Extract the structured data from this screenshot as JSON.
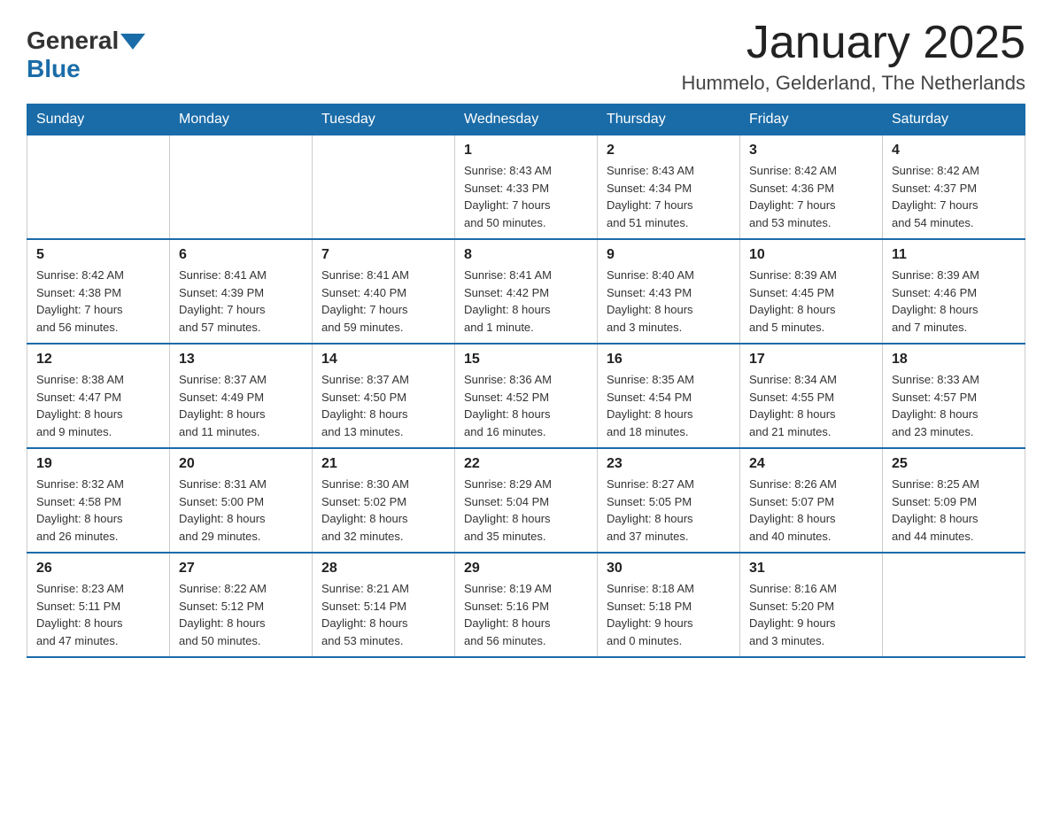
{
  "header": {
    "logo_general": "General",
    "logo_blue": "Blue",
    "month_title": "January 2025",
    "location": "Hummelo, Gelderland, The Netherlands"
  },
  "days_of_week": [
    "Sunday",
    "Monday",
    "Tuesday",
    "Wednesday",
    "Thursday",
    "Friday",
    "Saturday"
  ],
  "weeks": [
    [
      {
        "day": "",
        "info": ""
      },
      {
        "day": "",
        "info": ""
      },
      {
        "day": "",
        "info": ""
      },
      {
        "day": "1",
        "info": "Sunrise: 8:43 AM\nSunset: 4:33 PM\nDaylight: 7 hours\nand 50 minutes."
      },
      {
        "day": "2",
        "info": "Sunrise: 8:43 AM\nSunset: 4:34 PM\nDaylight: 7 hours\nand 51 minutes."
      },
      {
        "day": "3",
        "info": "Sunrise: 8:42 AM\nSunset: 4:36 PM\nDaylight: 7 hours\nand 53 minutes."
      },
      {
        "day": "4",
        "info": "Sunrise: 8:42 AM\nSunset: 4:37 PM\nDaylight: 7 hours\nand 54 minutes."
      }
    ],
    [
      {
        "day": "5",
        "info": "Sunrise: 8:42 AM\nSunset: 4:38 PM\nDaylight: 7 hours\nand 56 minutes."
      },
      {
        "day": "6",
        "info": "Sunrise: 8:41 AM\nSunset: 4:39 PM\nDaylight: 7 hours\nand 57 minutes."
      },
      {
        "day": "7",
        "info": "Sunrise: 8:41 AM\nSunset: 4:40 PM\nDaylight: 7 hours\nand 59 minutes."
      },
      {
        "day": "8",
        "info": "Sunrise: 8:41 AM\nSunset: 4:42 PM\nDaylight: 8 hours\nand 1 minute."
      },
      {
        "day": "9",
        "info": "Sunrise: 8:40 AM\nSunset: 4:43 PM\nDaylight: 8 hours\nand 3 minutes."
      },
      {
        "day": "10",
        "info": "Sunrise: 8:39 AM\nSunset: 4:45 PM\nDaylight: 8 hours\nand 5 minutes."
      },
      {
        "day": "11",
        "info": "Sunrise: 8:39 AM\nSunset: 4:46 PM\nDaylight: 8 hours\nand 7 minutes."
      }
    ],
    [
      {
        "day": "12",
        "info": "Sunrise: 8:38 AM\nSunset: 4:47 PM\nDaylight: 8 hours\nand 9 minutes."
      },
      {
        "day": "13",
        "info": "Sunrise: 8:37 AM\nSunset: 4:49 PM\nDaylight: 8 hours\nand 11 minutes."
      },
      {
        "day": "14",
        "info": "Sunrise: 8:37 AM\nSunset: 4:50 PM\nDaylight: 8 hours\nand 13 minutes."
      },
      {
        "day": "15",
        "info": "Sunrise: 8:36 AM\nSunset: 4:52 PM\nDaylight: 8 hours\nand 16 minutes."
      },
      {
        "day": "16",
        "info": "Sunrise: 8:35 AM\nSunset: 4:54 PM\nDaylight: 8 hours\nand 18 minutes."
      },
      {
        "day": "17",
        "info": "Sunrise: 8:34 AM\nSunset: 4:55 PM\nDaylight: 8 hours\nand 21 minutes."
      },
      {
        "day": "18",
        "info": "Sunrise: 8:33 AM\nSunset: 4:57 PM\nDaylight: 8 hours\nand 23 minutes."
      }
    ],
    [
      {
        "day": "19",
        "info": "Sunrise: 8:32 AM\nSunset: 4:58 PM\nDaylight: 8 hours\nand 26 minutes."
      },
      {
        "day": "20",
        "info": "Sunrise: 8:31 AM\nSunset: 5:00 PM\nDaylight: 8 hours\nand 29 minutes."
      },
      {
        "day": "21",
        "info": "Sunrise: 8:30 AM\nSunset: 5:02 PM\nDaylight: 8 hours\nand 32 minutes."
      },
      {
        "day": "22",
        "info": "Sunrise: 8:29 AM\nSunset: 5:04 PM\nDaylight: 8 hours\nand 35 minutes."
      },
      {
        "day": "23",
        "info": "Sunrise: 8:27 AM\nSunset: 5:05 PM\nDaylight: 8 hours\nand 37 minutes."
      },
      {
        "day": "24",
        "info": "Sunrise: 8:26 AM\nSunset: 5:07 PM\nDaylight: 8 hours\nand 40 minutes."
      },
      {
        "day": "25",
        "info": "Sunrise: 8:25 AM\nSunset: 5:09 PM\nDaylight: 8 hours\nand 44 minutes."
      }
    ],
    [
      {
        "day": "26",
        "info": "Sunrise: 8:23 AM\nSunset: 5:11 PM\nDaylight: 8 hours\nand 47 minutes."
      },
      {
        "day": "27",
        "info": "Sunrise: 8:22 AM\nSunset: 5:12 PM\nDaylight: 8 hours\nand 50 minutes."
      },
      {
        "day": "28",
        "info": "Sunrise: 8:21 AM\nSunset: 5:14 PM\nDaylight: 8 hours\nand 53 minutes."
      },
      {
        "day": "29",
        "info": "Sunrise: 8:19 AM\nSunset: 5:16 PM\nDaylight: 8 hours\nand 56 minutes."
      },
      {
        "day": "30",
        "info": "Sunrise: 8:18 AM\nSunset: 5:18 PM\nDaylight: 9 hours\nand 0 minutes."
      },
      {
        "day": "31",
        "info": "Sunrise: 8:16 AM\nSunset: 5:20 PM\nDaylight: 9 hours\nand 3 minutes."
      },
      {
        "day": "",
        "info": ""
      }
    ]
  ]
}
